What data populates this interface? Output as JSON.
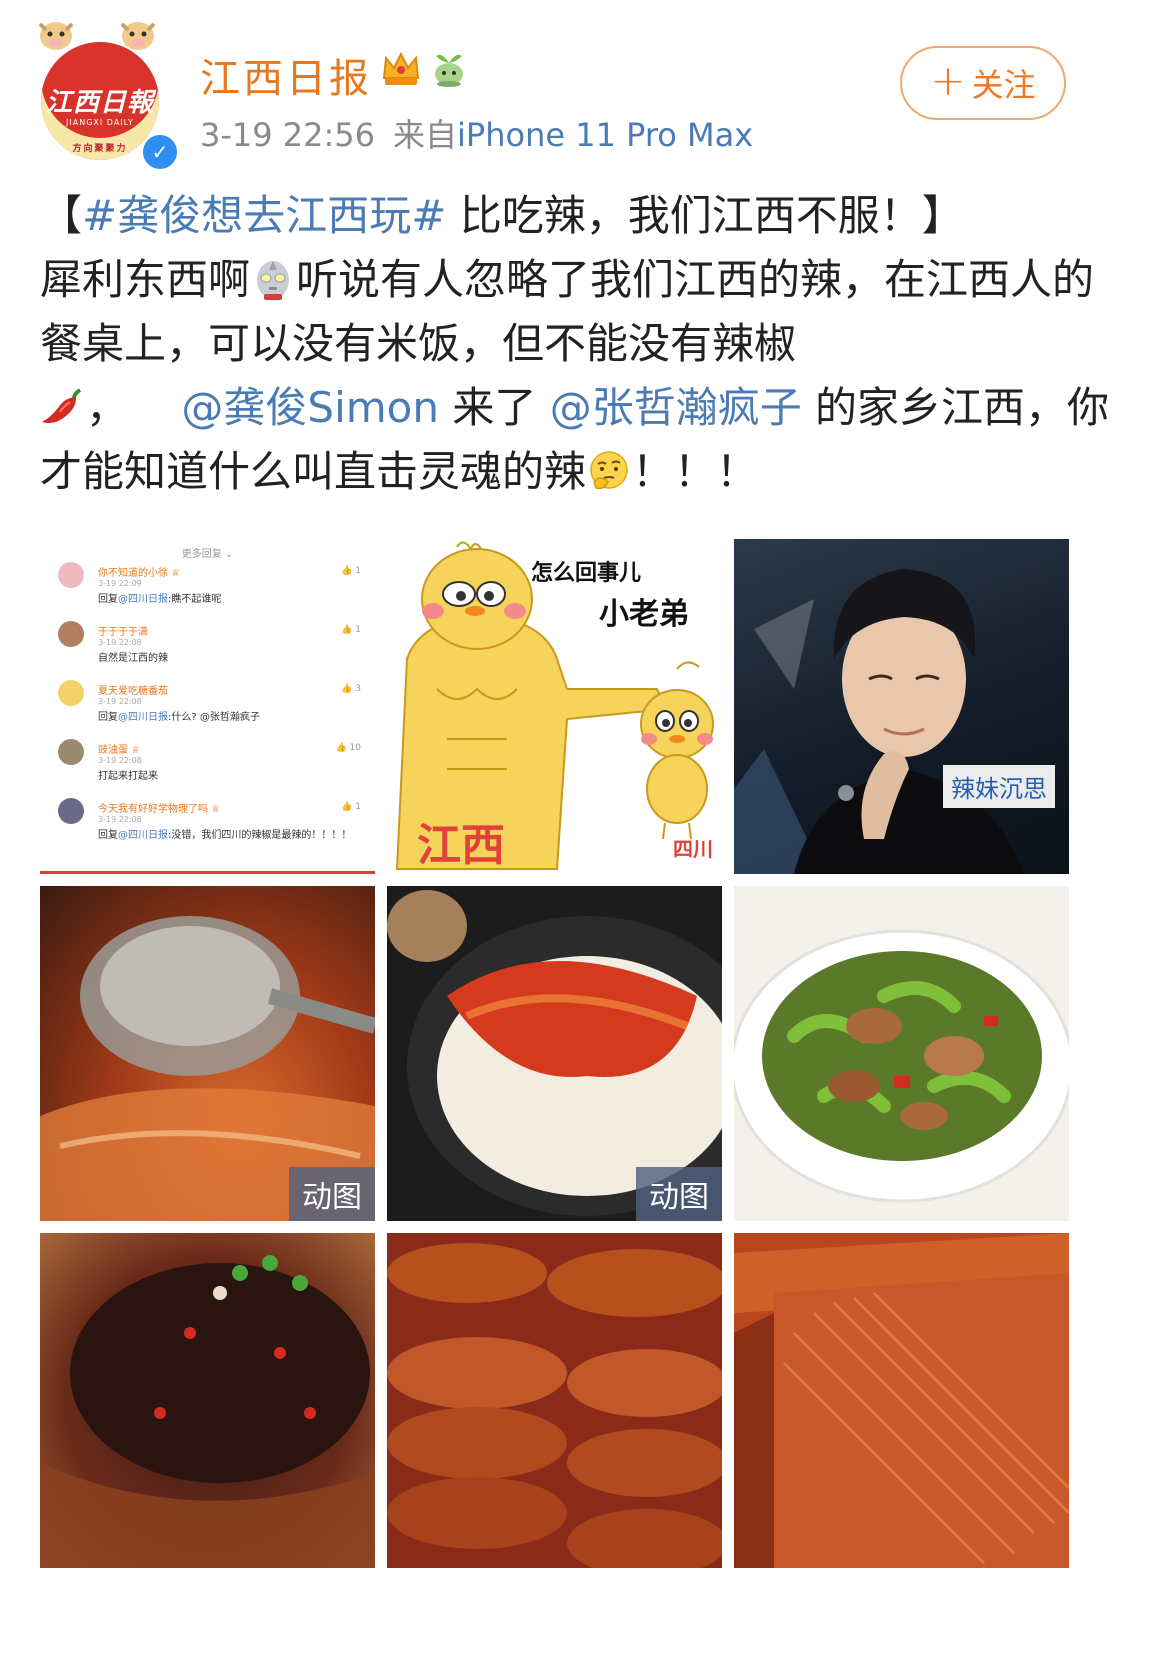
{
  "header": {
    "nickname": "江西日报",
    "time": "3-19 22:56",
    "source_prefix": "来自",
    "device": "iPhone 11 Pro Max",
    "follow_label": "关注",
    "follow_plus": "+",
    "avatar_logo": "江西日報",
    "avatar_sub": "JIANGXI DAILY",
    "avatar_slogan": "方向聚聚力"
  },
  "post": {
    "bracket_open": "【",
    "topic": "#龚俊想去江西玩#",
    "headline": " 比吃辣，我们江西不服！】",
    "line2a": "犀利东西啊",
    "line2b": "听说有人忽略了我们江西的辣，在江西人的餐桌上，可以没有米饭，但不能没有辣椒",
    "comma": "，",
    "mention1": "@龚俊Simon",
    "text3": " 来了 ",
    "mention2": "@张哲瀚疯子",
    "text4": " 的家乡江西，你才能知道什么叫直击灵魂的辣",
    "end": "！！！"
  },
  "images": {
    "gif_label": "动图",
    "comments": {
      "more": "更多回复 ⌄",
      "rows": [
        {
          "name": "你不知道的小徐 ♕",
          "time": "3-19 22:09",
          "prefix": "回复",
          "mention": "@四川日报",
          "text": ":瞧不起谁呢",
          "likes": "1"
        },
        {
          "name": "于于于于潇",
          "time": "3-19 22:08",
          "prefix": "",
          "mention": "",
          "text": "自然是江西的辣",
          "likes": "1"
        },
        {
          "name": "夏天爱吃糖番茄",
          "time": "3-19 22:08",
          "prefix": "回复",
          "mention": "@四川日报",
          "text": ":什么? @张哲瀚疯子",
          "likes": "3"
        },
        {
          "name": "豉油蛋 ♕",
          "time": "3-19 22:08",
          "prefix": "",
          "mention": "",
          "text": "打起来打起来",
          "likes": "10"
        },
        {
          "name": "今天我有好好学物理了吗 ♕",
          "time": "3-19 22:08",
          "prefix": "回复",
          "mention": "@四川日报",
          "text": ":没错，我们四川的辣椒是最辣的！！！！",
          "likes": "1"
        }
      ]
    },
    "meme": {
      "caption1": "怎么回事儿",
      "caption2": "小老弟",
      "label_big": "江西",
      "label_small": "四川"
    },
    "portrait_tag": "辣妹沉思"
  },
  "colors": {
    "nickname": "#e8781d",
    "link": "#4a7bb5",
    "meta": "#8a8a8a",
    "follow_border": "#f3a66a",
    "verified": "#2f8ff0"
  },
  "icons": [
    "verified-icon",
    "crown-badge-icon",
    "sprout-badge-icon",
    "ultraman-emoji-icon",
    "chili-emoji-icon",
    "thinking-emoji-icon"
  ]
}
